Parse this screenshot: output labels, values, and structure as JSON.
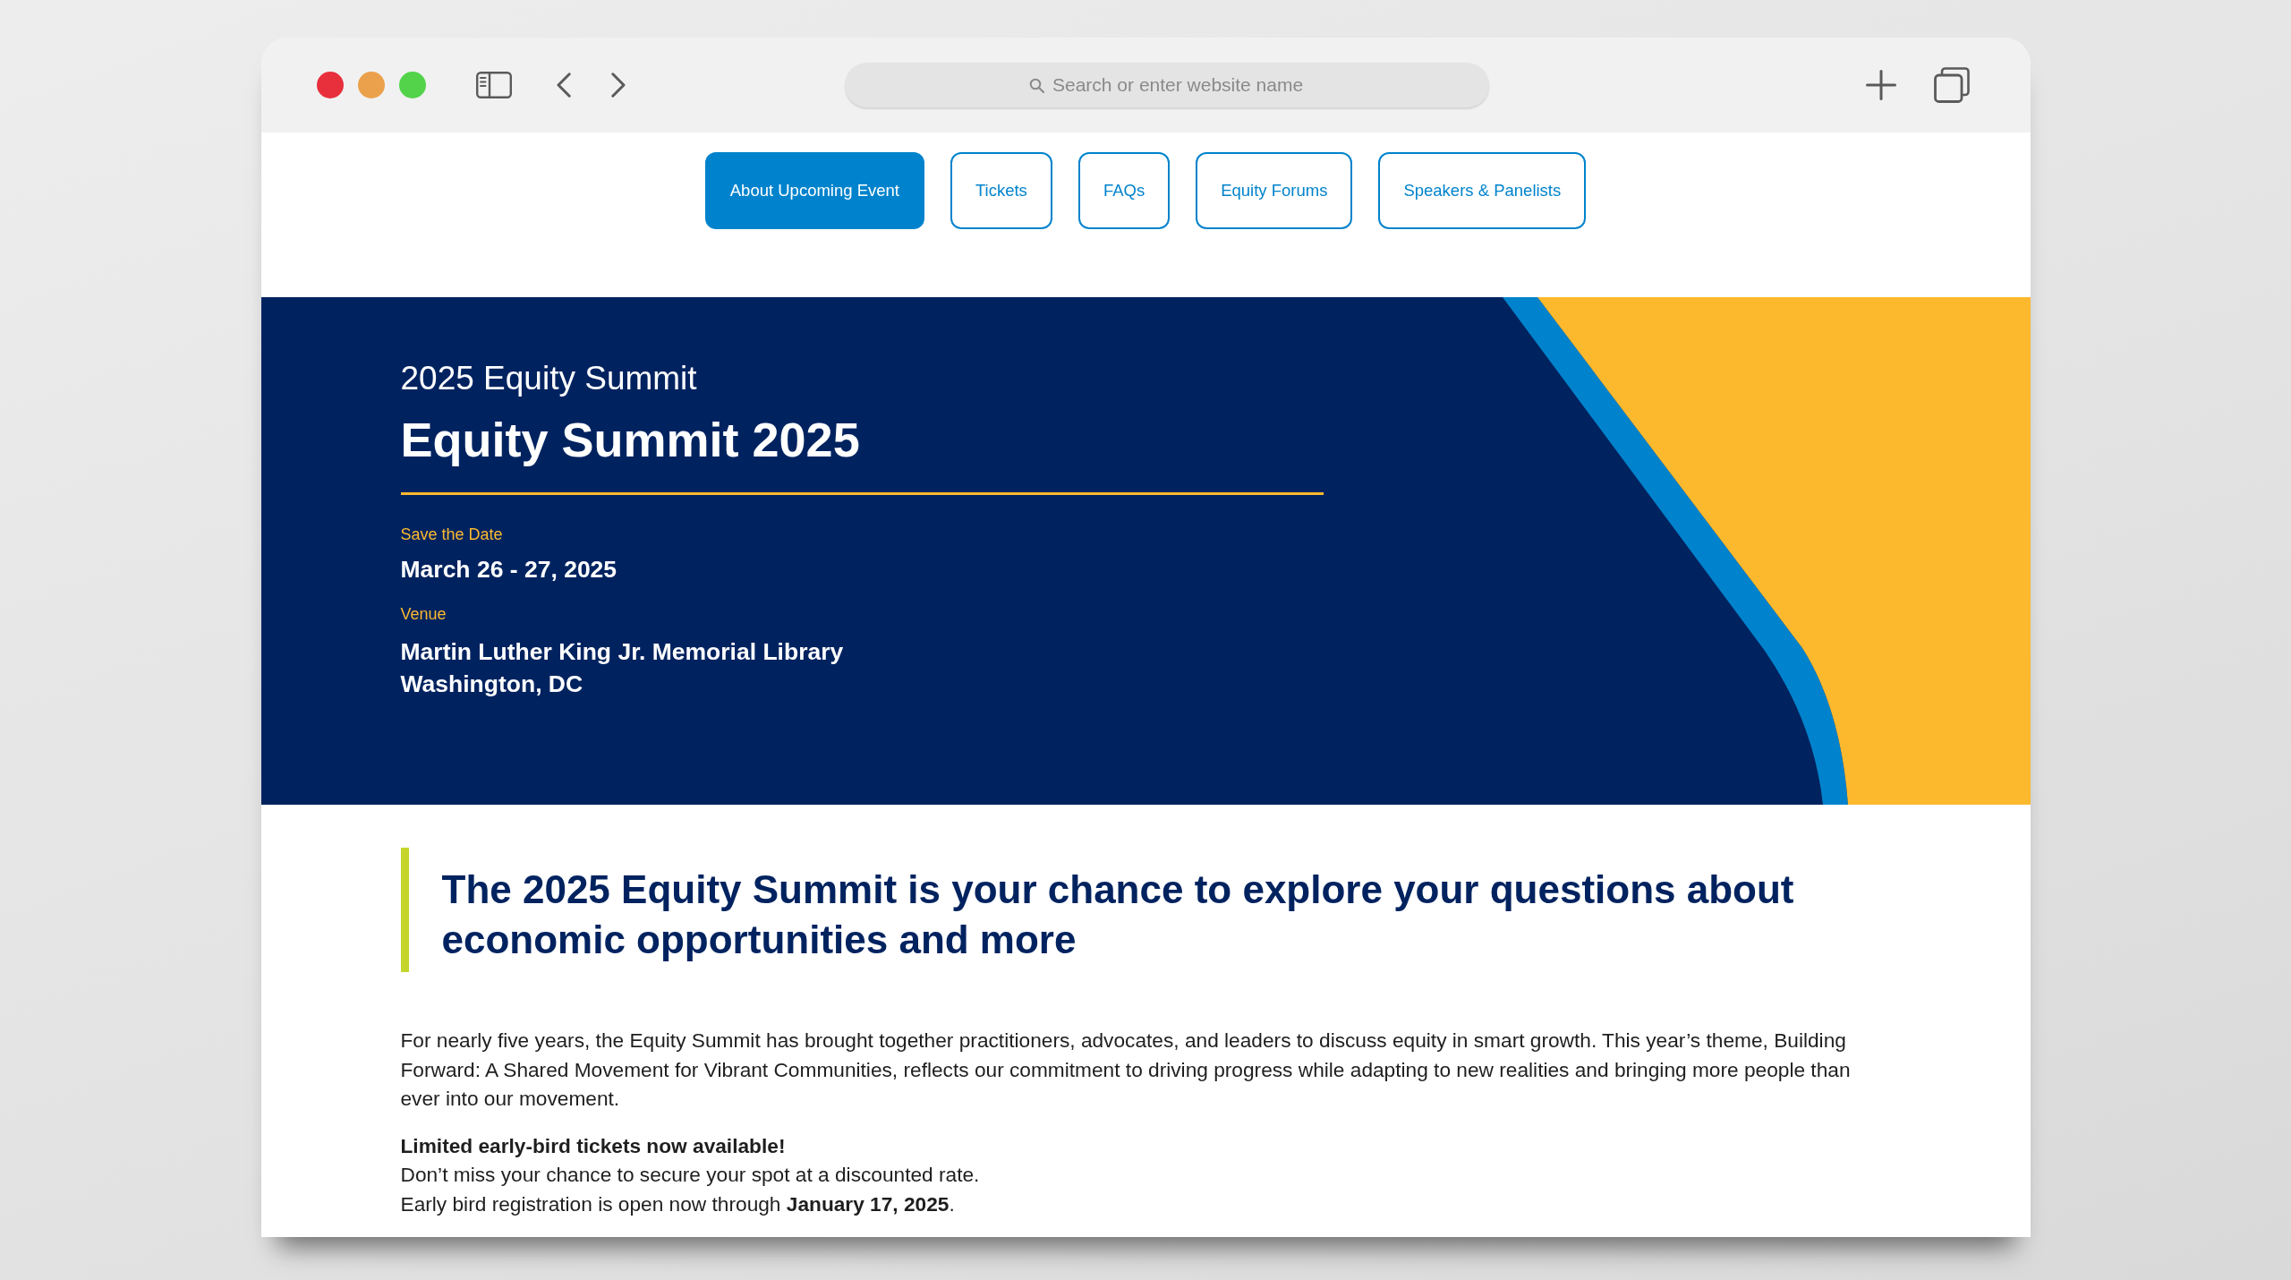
{
  "browser": {
    "address_placeholder": "Search or enter website name"
  },
  "nav": [
    {
      "label": "About Upcoming Event",
      "selected": true
    },
    {
      "label": "Tickets",
      "selected": false
    },
    {
      "label": "FAQs",
      "selected": false
    },
    {
      "label": "Equity Forums",
      "selected": false
    },
    {
      "label": "Speakers & Panelists",
      "selected": false
    }
  ],
  "hero": {
    "subtitle": "2025 Equity Summit",
    "title": "Equity Summit 2025",
    "details": [
      {
        "label": "Save the Date",
        "lines": [
          "March 26 - 27, 2025"
        ]
      },
      {
        "label": "Venue",
        "lines": [
          "Martin Luther King Jr. Memorial Library",
          "Washington, DC"
        ]
      }
    ]
  },
  "intro": {
    "pull_quote": "The 2025 Equity Summit is your chance to explore your questions about economic opportunities and more",
    "paragraph": "For nearly five years, the Equity Summit has brought together practitioners, advocates, and leaders to discuss equity in smart growth. This year’s theme, Building Forward: A Shared Movement for Vibrant Communities, reflects our commitment to driving progress while adapting to new realities and bringing more people than ever into our movement.",
    "notice": {
      "heading": "Limited early-bird tickets now available!",
      "lines": [
        "Don’t miss your chance to secure your spot at a discounted rate.",
        "Early bird registration is open now through **January 17, 2025**."
      ]
    }
  }
}
